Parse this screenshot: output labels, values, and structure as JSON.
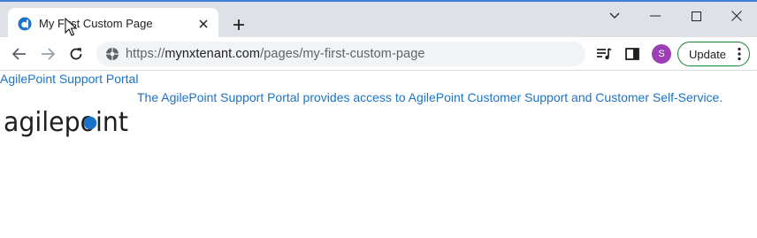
{
  "browser": {
    "tab": {
      "title": "My First Custom Page",
      "favicon": "agilepoint-favicon"
    },
    "url": {
      "scheme": "https://",
      "host": "mynxtenant.com",
      "path": "/pages/my-first-custom-page"
    },
    "profile_initial": "S",
    "update_label": "Update"
  },
  "page": {
    "portal_link": "AgilePoint Support Portal",
    "description": "The AgilePoint Support Portal provides access to AgilePoint Customer Support and Customer Self-Service.",
    "logo_text": "agilepoint"
  },
  "colors": {
    "link": "#1a73c8",
    "tab_strip": "#dee1e6",
    "accent_border": "#3b82d8",
    "avatar": "#9c3fb5",
    "update_border": "#188038"
  }
}
